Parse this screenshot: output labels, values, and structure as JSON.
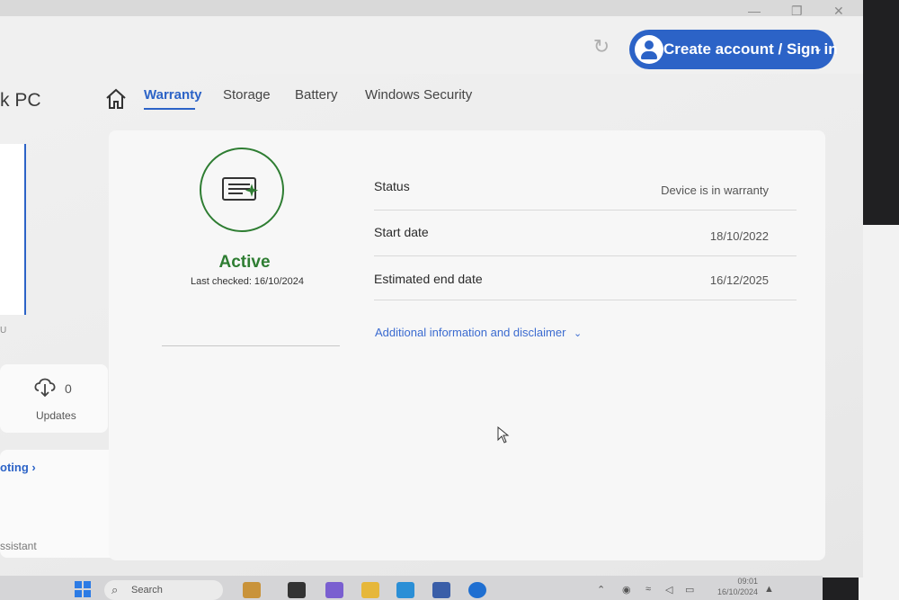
{
  "window": {
    "minimize": "—",
    "maximize": "❐",
    "close": "✕"
  },
  "header": {
    "refresh_icon": "refresh-icon",
    "account_button_label": "Create account / Sign in",
    "account_chevron": "⌄",
    "device_name_fragment": "k PC"
  },
  "tabs": [
    {
      "label": "Warranty",
      "active": true
    },
    {
      "label": "Storage",
      "active": false
    },
    {
      "label": "Battery",
      "active": false
    },
    {
      "label": "Windows Security",
      "active": false
    }
  ],
  "sidebar": {
    "edge_text": "U",
    "updates_count": "0",
    "updates_label": "Updates",
    "troubleshooting_fragment": "oting ›",
    "assistant_fragment": "ssistant"
  },
  "warranty": {
    "status_title": "Active",
    "last_checked": "Last checked: 16/10/2024",
    "rows": [
      {
        "label": "Status",
        "value": "Device is in warranty"
      },
      {
        "label": "Start date",
        "value": "18/10/2022"
      },
      {
        "label": "Estimated end date",
        "value": "16/12/2025"
      }
    ],
    "more_info": "Additional information and disclaimer",
    "more_chevron": "⌄"
  },
  "taskbar": {
    "search_placeholder": "Search",
    "time": "09:01",
    "date": "16/10/2024"
  },
  "colors": {
    "accent": "#2c63c7",
    "success": "#2e7d32"
  }
}
